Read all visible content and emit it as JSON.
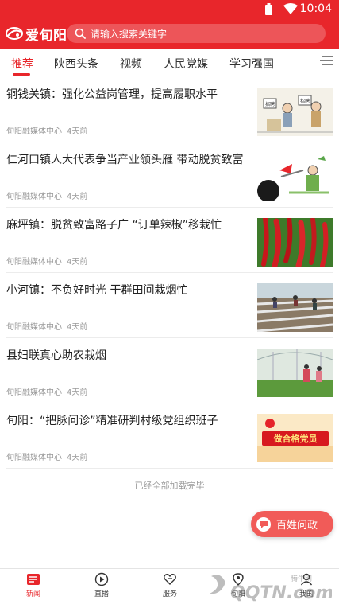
{
  "statusbar": {
    "time": "10:04"
  },
  "app": {
    "logo_text": "爱旬阳"
  },
  "search": {
    "placeholder": "请输入搜索关键字"
  },
  "tabs": [
    {
      "label": "推荐",
      "active": true
    },
    {
      "label": "陕西头条"
    },
    {
      "label": "视频"
    },
    {
      "label": "人民党媒"
    },
    {
      "label": "学习强国"
    }
  ],
  "news": [
    {
      "title": "铜钱关镇：强化公益岗管理，提高履职水平",
      "source": "旬阳融媒体中心",
      "time": "4天前"
    },
    {
      "title": "仁河口镇人大代表争当产业领头雁 带动脱贫致富",
      "source": "旬阳融媒体中心",
      "time": "4天前"
    },
    {
      "title": "麻坪镇：脱贫致富路子广 “订单辣椒”移栽忙",
      "source": "旬阳融媒体中心",
      "time": "4天前"
    },
    {
      "title": "小河镇：不负好时光 干群田间栽烟忙",
      "source": "旬阳融媒体中心",
      "time": "4天前"
    },
    {
      "title": "县妇联真心助农栽烟",
      "source": "旬阳融媒体中心",
      "time": "4天前"
    },
    {
      "title": "旬阳：“把脉问诊”精准研判村级党组织班子",
      "source": "旬阳融媒体中心",
      "time": "4天前"
    }
  ],
  "thumb_text": {
    "cartoon_sign_left": "招聘",
    "cartoon_sign_right": "招聘",
    "party_banner": "做合格党员"
  },
  "footer": {
    "loaded_text": "已经全部加载完毕"
  },
  "fab": {
    "label": "百姓问政"
  },
  "bottom_nav": [
    {
      "label": "新闻",
      "active": true
    },
    {
      "label": "直播"
    },
    {
      "label": "服务"
    },
    {
      "label": "旬阳"
    },
    {
      "label": "我的"
    }
  ],
  "watermark": {
    "small": "腾牛网",
    "big": "QQTN.com"
  },
  "colors": {
    "brand": "#e8262b",
    "fab": "#f15b58"
  }
}
